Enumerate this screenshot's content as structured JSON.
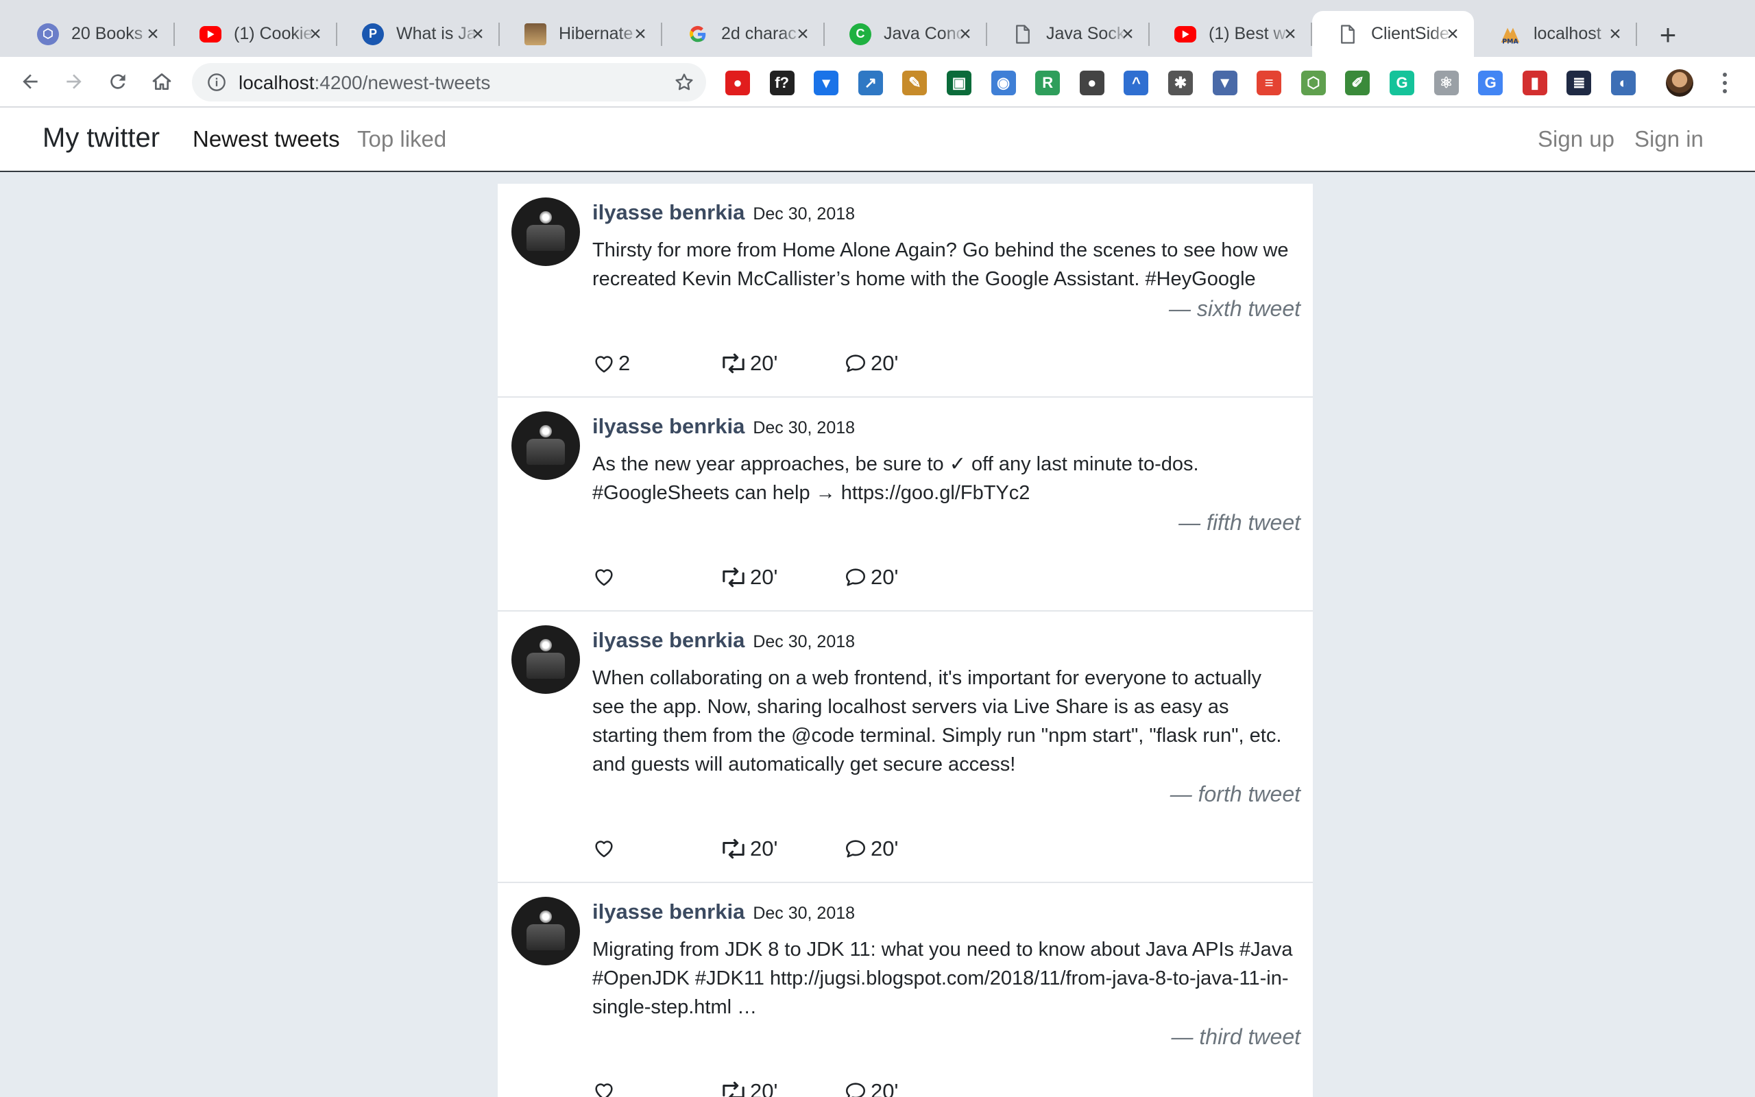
{
  "browser": {
    "tabs": [
      {
        "title": "20 Books",
        "favicon": "hexagon-icon",
        "color": "#6b7ec9"
      },
      {
        "title": "(1) Cookie",
        "favicon": "youtube-icon",
        "color": "#ff0000"
      },
      {
        "title": "What is Ja",
        "favicon": "p-letter-icon",
        "color": "#1a57b0"
      },
      {
        "title": "Hibernate",
        "favicon": "photo-icon",
        "color": "#c9a46b"
      },
      {
        "title": "2d charac",
        "favicon": "google-icon",
        "color": "#4285f4"
      },
      {
        "title": "Java Conc",
        "favicon": "c-letter-icon",
        "color": "#1fb141"
      },
      {
        "title": "Java Sock",
        "favicon": "document-icon",
        "color": "#5f6368"
      },
      {
        "title": "(1) Best w",
        "favicon": "youtube-icon",
        "color": "#ff0000"
      },
      {
        "title": "ClientSide",
        "favicon": "document-icon",
        "color": "#5f6368"
      },
      {
        "title": "localhost",
        "favicon": "pma-icon",
        "color": "#e8a33d"
      }
    ],
    "active_tab_index": 8,
    "url_host": "localhost",
    "url_path": ":4200/newest-tweets",
    "extensions": [
      {
        "name": "opera-icon",
        "color": "#e11d1d",
        "glyph": "●"
      },
      {
        "name": "font-f-icon",
        "color": "#222222",
        "glyph": "f?"
      },
      {
        "name": "download-icon",
        "color": "#1a73e8",
        "glyph": "▾"
      },
      {
        "name": "chart-icon",
        "color": "#2f78c4",
        "glyph": "↗"
      },
      {
        "name": "pencil-icon",
        "color": "#c78b2a",
        "glyph": "✎"
      },
      {
        "name": "screenshot-icon",
        "color": "#0b6b3a",
        "glyph": "▣"
      },
      {
        "name": "camera-icon",
        "color": "#3f7fd6",
        "glyph": "◉"
      },
      {
        "name": "r-letter-icon",
        "color": "#2e9e5b",
        "glyph": "R"
      },
      {
        "name": "bulb-icon",
        "color": "#444444",
        "glyph": "●"
      },
      {
        "name": "caret-icon",
        "color": "#2f6fd1",
        "glyph": "^"
      },
      {
        "name": "gear-icon",
        "color": "#555555",
        "glyph": "✱"
      },
      {
        "name": "png-icon",
        "color": "#4a6aa8",
        "glyph": "▼"
      },
      {
        "name": "todoist-icon",
        "color": "#e44332",
        "glyph": "≡"
      },
      {
        "name": "nodejs-icon",
        "color": "#5fa04e",
        "glyph": "⬡"
      },
      {
        "name": "dropper-icon",
        "color": "#3a8a3a",
        "glyph": "✐"
      },
      {
        "name": "grammarly-icon",
        "color": "#15c39a",
        "glyph": "G"
      },
      {
        "name": "react-icon",
        "color": "#9aa0a6",
        "glyph": "⚛"
      },
      {
        "name": "translate-icon",
        "color": "#4285f4",
        "glyph": "G"
      },
      {
        "name": "colorzilla-icon",
        "color": "#d32f2f",
        "glyph": "▮"
      },
      {
        "name": "server-icon",
        "color": "#1f2a44",
        "glyph": "≣"
      },
      {
        "name": "globe-icon",
        "color": "#3d6fb6",
        "glyph": "◐"
      }
    ]
  },
  "app": {
    "brand": "My twitter",
    "nav": {
      "newest": "Newest tweets",
      "top": "Top liked",
      "signup": "Sign up",
      "signin": "Sign in"
    }
  },
  "tweets": [
    {
      "author": "ilyasse benrkia",
      "date": "Dec 30, 2018",
      "content": "Thirsty for more from Home Alone Again? Go behind the scenes to see how we recreated Kevin McCallister’s home with the Google Assistant. #HeyGoogle",
      "footer": "— sixth tweet",
      "likes": "2",
      "retweets": "20'",
      "replies": "20'"
    },
    {
      "author": "ilyasse benrkia",
      "date": "Dec 30, 2018",
      "content": "As the new year approaches, be sure to ✓ off any last minute to-dos. #GoogleSheets can help → https://goo.gl/FbTYc2",
      "footer": "— fifth tweet",
      "likes": "",
      "retweets": "20'",
      "replies": "20'"
    },
    {
      "author": "ilyasse benrkia",
      "date": "Dec 30, 2018",
      "content": "When collaborating on a web frontend, it's important for everyone to actually see the app. Now, sharing localhost servers via Live Share is as easy as starting them from the @code terminal. Simply run \"npm start\", \"flask run\", etc. and guests will automatically get secure access!",
      "footer": "— forth tweet",
      "likes": "",
      "retweets": "20'",
      "replies": "20'"
    },
    {
      "author": "ilyasse benrkia",
      "date": "Dec 30, 2018",
      "content": "Migrating from JDK 8 to JDK 11: what you need to know about Java APIs #Java #OpenJDK #JDK11 http://jugsi.blogspot.com/2018/11/from-java-8-to-java-11-in-single-step.html …",
      "footer": "— third tweet",
      "likes": "",
      "retweets": "20'",
      "replies": "20'"
    }
  ]
}
